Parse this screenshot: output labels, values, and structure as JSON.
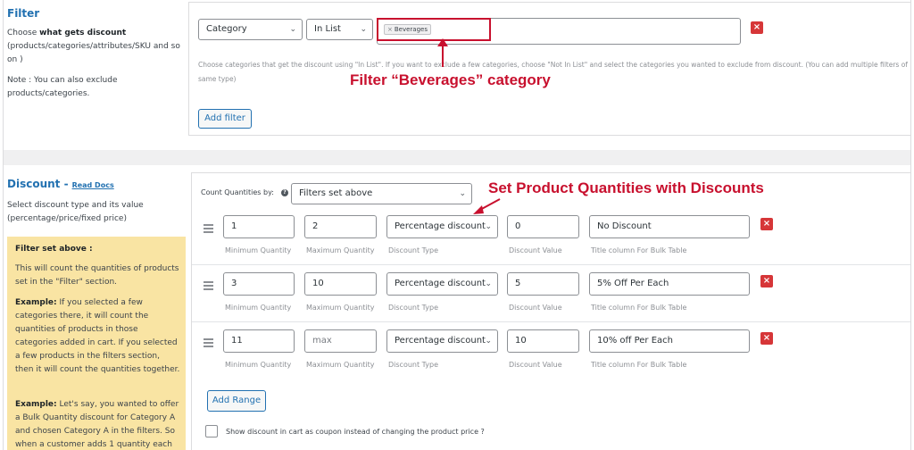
{
  "filter": {
    "title": "Filter",
    "desc_prefix": "Choose ",
    "desc_bold": "what gets discount",
    "desc_rest": "(products/categories/attributes/SKU and so on )",
    "note": "Note : You can also exclude products/categories.",
    "type_select": "Category",
    "method_select": "In List",
    "tag": "Beverages",
    "hint": "Choose categories that get the discount using \"In List\". If you want to exclude a few categories, choose \"Not In List\" and select the categories you wanted to exclude from discount. (You can add multiple filters of same type)",
    "add_filter": "Add filter"
  },
  "discount": {
    "title": "Discount -",
    "read_docs": "Read Docs",
    "desc": "Select discount type and its value (percentage/price/fixed price)",
    "count_label": "Count Quantities by:",
    "count_select": "Filters set above",
    "help_mark": "?",
    "info_box": {
      "heading": "Filter set above :",
      "p1": "This will count the quantities of products set in the \"Filter\" section.",
      "p2_bold": "Example:",
      "p2_rest": " If you selected a few categories there, it will count the quantities of products in those categories added in cart. If you selected a few products in the filters section, then it will count the quantities together.",
      "p3_bold": "Example:",
      "p3_rest": " Let's say, you wanted to offer a Bulk Quantity discount for Category A and chosen Category A in the filters. So when a customer adds 1 quantity each of"
    },
    "captions": {
      "min": "Minimum Quantity",
      "max": "Maximum Quantity",
      "type": "Discount Type",
      "value": "Discount Value",
      "title": "Title column For Bulk Table"
    },
    "ranges": [
      {
        "min": "1",
        "max": "2",
        "type": "Percentage discount",
        "value": "0",
        "title": "No Discount"
      },
      {
        "min": "3",
        "max": "10",
        "type": "Percentage discount",
        "value": "5",
        "title": "5% Off Per Each"
      },
      {
        "min": "11",
        "max": "max",
        "type": "Percentage discount",
        "value": "10",
        "title": "10% off Per Each"
      }
    ],
    "add_range": "Add Range",
    "coupon_label": "Show discount in cart as coupon instead of changing the product price ?"
  },
  "annotations": {
    "filter_label": "Filter “Beverages” category",
    "discount_label": "Set Product Quantities with Discounts"
  },
  "icons": {
    "close": "×",
    "chevron": "⌄"
  },
  "colors": {
    "accent": "#2271b1",
    "danger": "#d63638",
    "annotation": "#c8102e",
    "info_box": "#f9e4a3"
  }
}
